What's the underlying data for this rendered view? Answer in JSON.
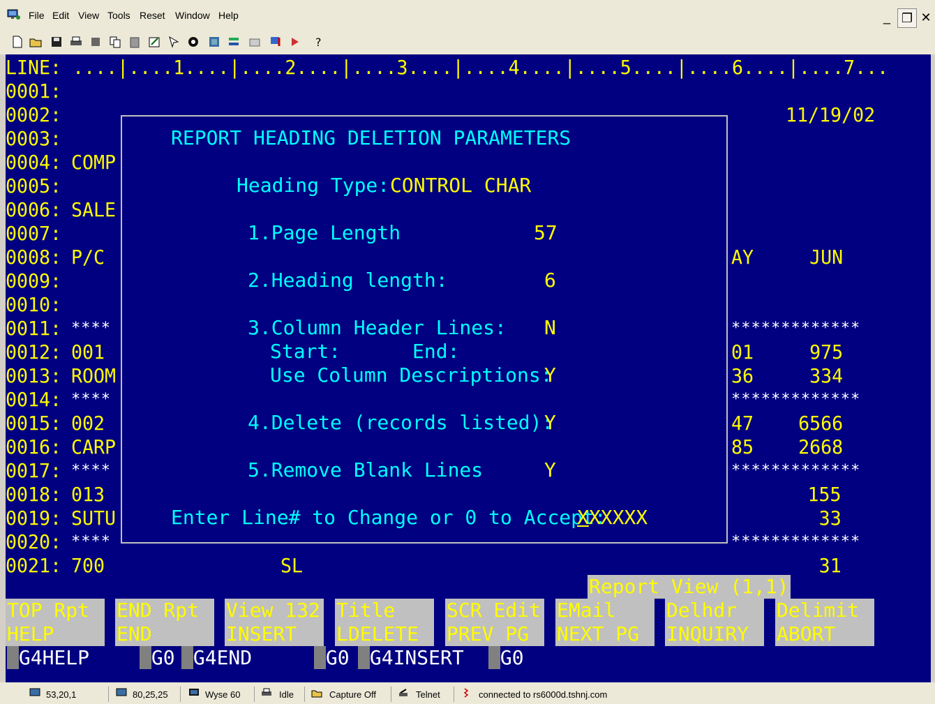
{
  "menubar": {
    "items": [
      {
        "label": "File"
      },
      {
        "label": "Edit"
      },
      {
        "label": "View"
      },
      {
        "label": "Tools"
      },
      {
        "label": "Reset"
      },
      {
        "label": "Window"
      },
      {
        "label": "Help"
      }
    ],
    "window_controls": {
      "minimize": "_",
      "restore": "❐",
      "close": "✕"
    }
  },
  "toolbar": {
    "icons": [
      "new-icon",
      "open-icon",
      "save-icon",
      "print-icon",
      "stamp-icon",
      "copy-icon",
      "paste-icon",
      "edit-icon",
      "select-icon",
      "macro-icon",
      "connect-icon",
      "settings-icon",
      "keyboard-icon",
      "message-icon",
      "run-icon",
      "help-icon"
    ]
  },
  "terminal": {
    "ruler": "LINE: ....|....1....|....2....|....3....|....4....|....5....|....6....|....7...",
    "lines": [
      {
        "num": "0001:",
        "left": "",
        "right": ""
      },
      {
        "num": "0002:",
        "left": "",
        "right": "11/19/02"
      },
      {
        "num": "0003:",
        "left": "",
        "right": ""
      },
      {
        "num": "0004:",
        "left": "COMP",
        "right": ""
      },
      {
        "num": "0005:",
        "left": "",
        "right": ""
      },
      {
        "num": "0006:",
        "left": "SALE",
        "right": ""
      },
      {
        "num": "0007:",
        "left": "",
        "right": ""
      },
      {
        "num": "0008:",
        "left": "P/C",
        "right": "AY     JUN"
      },
      {
        "num": "0009:",
        "left": "",
        "right": ""
      },
      {
        "num": "0010:",
        "left": "",
        "right": ""
      },
      {
        "num": "0011:",
        "left": "****",
        "right": "*************"
      },
      {
        "num": "0012:",
        "left": "001",
        "right": "01     975"
      },
      {
        "num": "0013:",
        "left": "ROOM",
        "right": "36     334"
      },
      {
        "num": "0014:",
        "left": "****",
        "right": "*************"
      },
      {
        "num": "0015:",
        "left": "002",
        "right": "47    6566"
      },
      {
        "num": "0016:",
        "left": "CARP",
        "right": "85    2668"
      },
      {
        "num": "0017:",
        "left": "****",
        "right": "*************"
      },
      {
        "num": "0018:",
        "left": "013",
        "right": "155"
      },
      {
        "num": "0019:",
        "left": "SUTU",
        "right": "33"
      },
      {
        "num": "0020:",
        "left": "****",
        "right": "*************"
      },
      {
        "num": "0021:",
        "left": "700",
        "middle": "SL",
        "right": "31"
      }
    ]
  },
  "dialog": {
    "title": "REPORT HEADING DELETION PARAMETERS",
    "heading_type_label": "Heading Type:",
    "heading_type_value": "CONTROL CHAR",
    "fields": [
      {
        "label": "1.Page Length",
        "value": "57"
      },
      {
        "label": "2.Heading length:",
        "value": "6"
      },
      {
        "label": "3.Column Header Lines:",
        "value": "N"
      },
      {
        "label": "4.Delete (records listed):",
        "value": "Y"
      },
      {
        "label": "5.Remove Blank Lines",
        "value": "Y"
      }
    ],
    "start_label": "Start:",
    "end_label": "End:",
    "use_col_desc_label": "Use Column Descriptions:",
    "use_col_desc_value": "Y",
    "prompt": "Enter Line# to Change or 0 to Accept:",
    "input_value": "XXXXXX"
  },
  "report_view": "Report View (1,1)",
  "function_keys": [
    {
      "top": "TOP Rpt",
      "bottom": "HELP"
    },
    {
      "top": "END Rpt",
      "bottom": "END"
    },
    {
      "top": "View 132",
      "bottom": "INSERT"
    },
    {
      "top": "Title",
      "bottom": "LDELETE"
    },
    {
      "top": "SCR Edit",
      "bottom": "PREV PG"
    },
    {
      "top": "EMail",
      "bottom": "NEXT PG"
    },
    {
      "top": "Delhdr",
      "bottom": "INQUIRY"
    },
    {
      "top": "Delimit",
      "bottom": "ABORT"
    }
  ],
  "gkeys": {
    "g4help": "G4HELP",
    "g0_1": "G0",
    "g4end": "G4END",
    "g0_2": "G0",
    "g4insert": "G4INSERT",
    "g0_3": "G0"
  },
  "statusbar": {
    "cursor": "53,20,1",
    "size": "80,25,25",
    "emulation": "Wyse 60",
    "printer": "Idle",
    "capture": "Capture Off",
    "protocol": "Telnet",
    "connection": "connected to rs6000d.tshnj.com"
  }
}
